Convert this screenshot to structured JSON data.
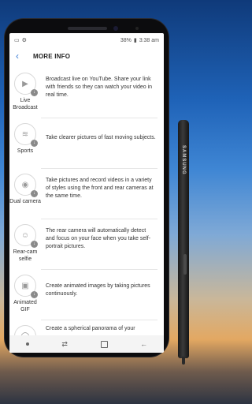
{
  "status_bar": {
    "battery": "38%",
    "time": "3:38 am"
  },
  "header": {
    "title": "MORE INFO"
  },
  "modes": [
    {
      "name": "Live Broadcast",
      "icon": "video-camera-icon",
      "description": "Broadcast live on YouTube. Share your link with friends so they can watch your video in real time."
    },
    {
      "name": "Sports",
      "icon": "sports-icon",
      "description": "Take clearer pictures of fast moving subjects."
    },
    {
      "name": "Dual camera",
      "icon": "camera-switch-icon",
      "description": "Take pictures and record videos in a variety of styles using the front and rear cameras at the same time."
    },
    {
      "name": "Rear-cam selfie",
      "icon": "selfie-face-icon",
      "description": "The rear camera will automatically detect and focus on your face when you take self-portrait pictures."
    },
    {
      "name": "Animated GIF",
      "icon": "gif-icon",
      "description": "Create animated images by taking pictures continuously."
    },
    {
      "name": "",
      "icon": "panorama-icon",
      "description": "Create a spherical panorama of your"
    }
  ],
  "stylus": {
    "brand": "SAMSUNG"
  },
  "colors": {
    "accent": "#3a7bd5",
    "wallpaper_top": "#0f3a7a",
    "wallpaper_horizon": "#e3a862"
  }
}
